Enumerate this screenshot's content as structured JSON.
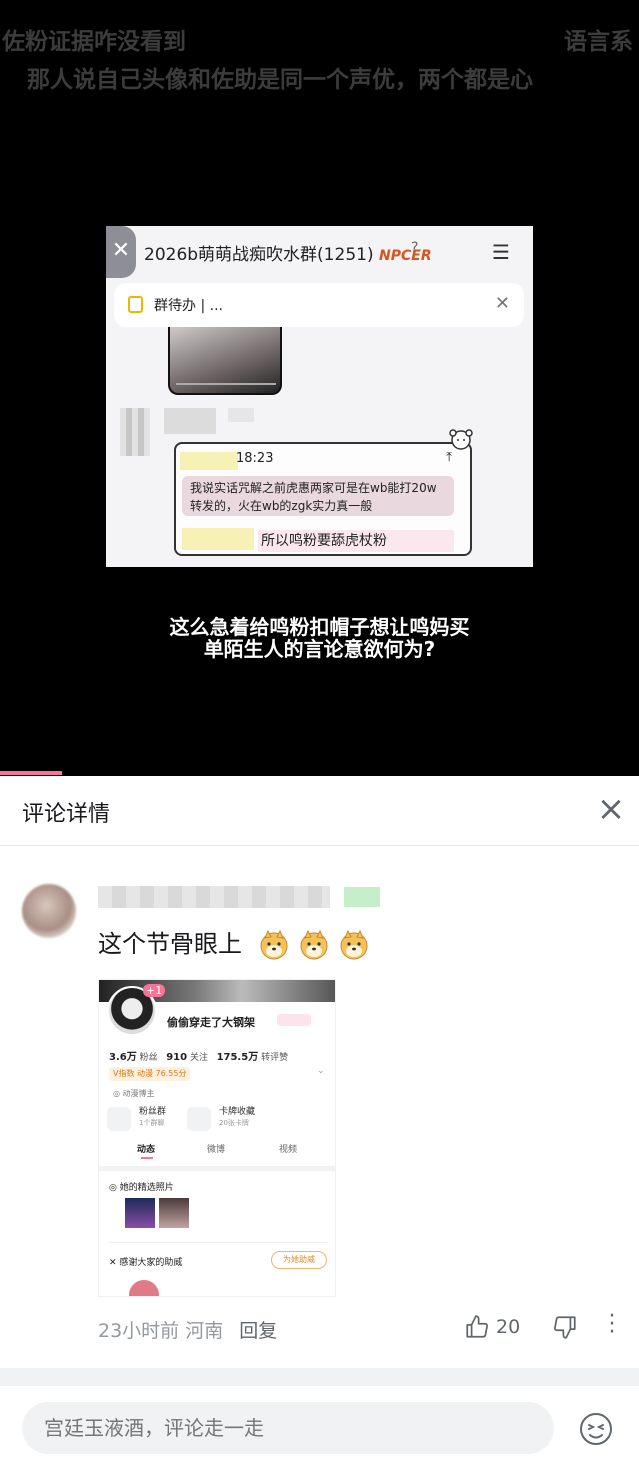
{
  "video": {
    "top_caption_1": "佐粉证据咋没看到",
    "top_caption_1_right": "语言系",
    "top_caption_2": "那人说自己头像和佐助是同一个声优，两个都是心",
    "screenshot": {
      "back_icon": "close-icon",
      "group_name": "2026b萌萌战痴吹水群(1251)",
      "group_tag": "NPCER",
      "todo_label": "群待办 | ...",
      "message_time": "18:23",
      "message_text": "我说实话咒解之前虎惠两家可是在wb能打20w转发的，火在wb的zgk实力真一般",
      "reply_text": "所以鸣粉要舔虎杖粉"
    },
    "subtitle_line1": "这么急着给鸣粉扣帽子想让鸣妈买",
    "subtitle_line2": "单陌生人的言论意欲何为?",
    "progress": 0.097
  },
  "panel": {
    "title": "评论详情",
    "comment": {
      "text": "这个节骨眼上",
      "emoji_count": 3,
      "time": "23小时前",
      "location": "河南",
      "reply_label": "回复",
      "like_count": "20"
    },
    "profile_image": {
      "plus_badge": "+1",
      "name": "偷偷穿走了大钢架",
      "fans": "3.6万",
      "fans_label": "粉丝",
      "following": "910",
      "following_label": "关注",
      "likes": "175.5万",
      "likes_label": "转评赞",
      "v_index": "V指数 动漫 76.55分",
      "certification": "动漫博主",
      "box1_title": "粉丝群",
      "box1_sub": "1个群聊",
      "box2_title": "卡牌收藏",
      "box2_sub": "20张卡牌",
      "tab1": "动态",
      "tab2": "微博",
      "tab3": "视频",
      "section1": "她的精选照片",
      "section2": "感谢大家的助威",
      "help_button": "为她助威"
    },
    "input_placeholder": "宫廷玉液酒，评论走一走",
    "colors": {
      "accent_pink": "#fb7299",
      "text_gray": "#9499a0"
    }
  }
}
